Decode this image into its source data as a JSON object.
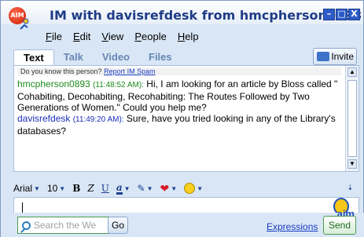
{
  "window": {
    "title": "IM with davisrefdesk from hmcpherson0893",
    "logo_text": "AIM",
    "controls": {
      "minimize": "–",
      "restore": "□",
      "close": "X"
    }
  },
  "menu": [
    "File",
    "Edit",
    "View",
    "People",
    "Help"
  ],
  "tabs": [
    "Text",
    "Talk",
    "Video",
    "Files"
  ],
  "invite_label": "Invite",
  "know_prompt": "Do you know this person?",
  "report_spam": "Report IM Spam",
  "messages": [
    {
      "sender": "hmcpherson0893",
      "time": "(11:48:52 AM):",
      "text": "Hi, I am looking for an article by Bloss called \" Cohabiting, Decohabiting, Recohabiting: The Routes Followed by Two Generations of Women.\"  Could you help me?"
    },
    {
      "sender": "davisrefdesk",
      "time": "(11:49:20 AM):",
      "text": "Sure, have you tried looking in any of the Library's databases?"
    }
  ],
  "format_bar": {
    "font": "Arial",
    "size": "10",
    "bold": "B",
    "italic": "Z",
    "underline": "U",
    "font_color": "a"
  },
  "brand": "aim",
  "search_placeholder": "Search the We",
  "go_label": "Go",
  "expressions_label": "Expressions",
  "send_label": "Send",
  "colors": {
    "title": "#1f3c86",
    "sender_local": "#1d8a1d",
    "sender_remote": "#1b2fb8",
    "link": "#1a3ec2"
  }
}
